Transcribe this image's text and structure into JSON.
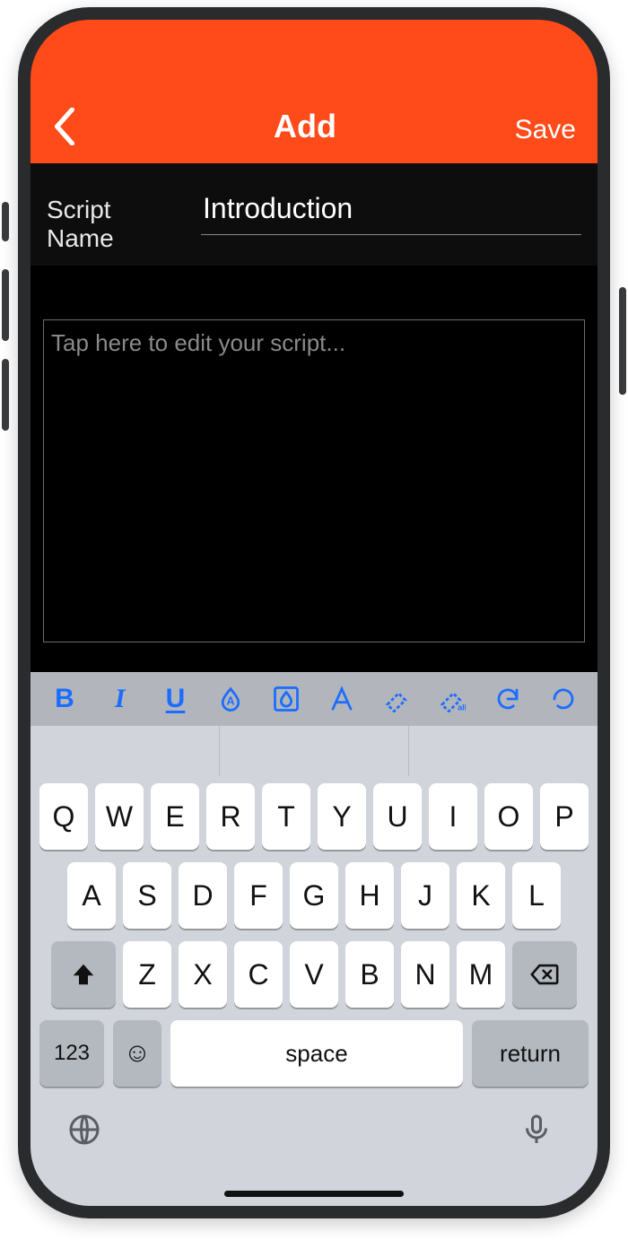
{
  "nav": {
    "title": "Add",
    "save": "Save"
  },
  "script": {
    "name_label": "Script Name",
    "name_value": "Introduction",
    "body_placeholder": "Tap here to edit your script..."
  },
  "format_toolbar": {
    "bold": "B",
    "italic": "I",
    "underline": "U"
  },
  "keyboard": {
    "row1": [
      "Q",
      "W",
      "E",
      "R",
      "T",
      "Y",
      "U",
      "I",
      "O",
      "P"
    ],
    "row2": [
      "A",
      "S",
      "D",
      "F",
      "G",
      "H",
      "J",
      "K",
      "L"
    ],
    "row3": [
      "Z",
      "X",
      "C",
      "V",
      "B",
      "N",
      "M"
    ],
    "numkey": "123",
    "space": "space",
    "return": "return"
  }
}
